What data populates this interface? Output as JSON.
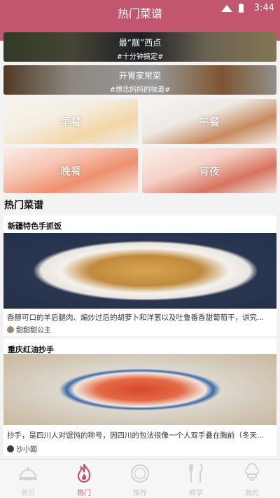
{
  "status_bar": {
    "time": "3:44"
  },
  "header": {
    "title": "热门菜谱"
  },
  "banners": [
    {
      "title": "最“靓”西点",
      "subtitle": "#十分钟搞定#"
    },
    {
      "title": "开胃家常菜",
      "subtitle": "#想念妈妈的味道#"
    }
  ],
  "meals": [
    {
      "label": "早餐"
    },
    {
      "label": "午餐"
    },
    {
      "label": "晚餐"
    },
    {
      "label": "宵夜"
    }
  ],
  "section": {
    "title": "热门菜谱"
  },
  "recipes": [
    {
      "title": "新疆特色手抓饭",
      "description": "香醇可口的羊后腿肉、煸炒过后的胡萝卜和洋葱以及吐鲁番香甜葡萄干，讲究...",
      "author": "甜甜甜公主"
    },
    {
      "title": "重庆红油抄手",
      "description": "抄手，是四川人对馄饨的称号，因四川的包法很像一个人双手叠在胸前（冬天...",
      "author": "沙小囡"
    }
  ],
  "nav": [
    {
      "label": "首页",
      "icon": "cloche-icon",
      "active": false
    },
    {
      "label": "热门",
      "icon": "flame-icon",
      "active": true
    },
    {
      "label": "推荐",
      "icon": "plate-icon",
      "active": false
    },
    {
      "label": "教学",
      "icon": "utensils-icon",
      "active": false
    },
    {
      "label": "我的",
      "icon": "chef-hat-icon",
      "active": false
    }
  ],
  "colors": {
    "primary": "#c2566f",
    "inactive": "#c9c9c9"
  }
}
